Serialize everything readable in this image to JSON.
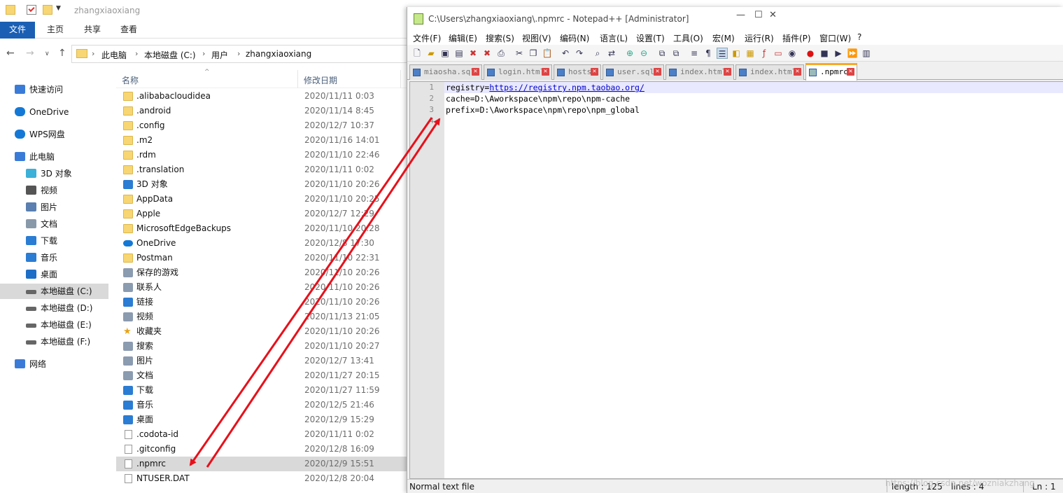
{
  "explorer": {
    "window_title": "zhangxiaoxiang",
    "ribbon_tabs": [
      "文件",
      "主页",
      "共享",
      "查看"
    ],
    "breadcrumb": [
      "此电脑",
      "本地磁盘 (C:)",
      "用户",
      "zhangxiaoxiang"
    ],
    "columns": {
      "name": "名称",
      "date": "修改日期"
    },
    "nav_items": [
      {
        "label": "快速访问",
        "icon": "star-icon"
      },
      {
        "label": "OneDrive",
        "icon": "cloud-icon"
      },
      {
        "label": "WPS网盘",
        "icon": "cloud-icon"
      },
      {
        "label": "此电脑",
        "icon": "computer-icon"
      },
      {
        "label": "3D 对象",
        "icon": "cube-icon"
      },
      {
        "label": "视频",
        "icon": "video-icon"
      },
      {
        "label": "图片",
        "icon": "picture-icon"
      },
      {
        "label": "文档",
        "icon": "document-icon"
      },
      {
        "label": "下载",
        "icon": "download-icon"
      },
      {
        "label": "音乐",
        "icon": "music-icon"
      },
      {
        "label": "桌面",
        "icon": "desktop-icon"
      },
      {
        "label": "本地磁盘 (C:)",
        "icon": "drive-icon"
      },
      {
        "label": "本地磁盘 (D:)",
        "icon": "drive-icon"
      },
      {
        "label": "本地磁盘 (E:)",
        "icon": "drive-icon"
      },
      {
        "label": "本地磁盘 (F:)",
        "icon": "drive-icon"
      },
      {
        "label": "网络",
        "icon": "network-icon"
      }
    ],
    "files": [
      {
        "name": ".alibabacloudidea",
        "date": "2020/11/11 0:03",
        "icon": "folder"
      },
      {
        "name": ".android",
        "date": "2020/11/14 8:45",
        "icon": "folder"
      },
      {
        "name": ".config",
        "date": "2020/12/7 10:37",
        "icon": "folder"
      },
      {
        "name": ".m2",
        "date": "2020/11/16 14:01",
        "icon": "folder"
      },
      {
        "name": ".rdm",
        "date": "2020/11/10 22:46",
        "icon": "folder"
      },
      {
        "name": ".translation",
        "date": "2020/11/11 0:02",
        "icon": "folder"
      },
      {
        "name": "3D 对象",
        "date": "2020/11/10 20:26",
        "icon": "cube"
      },
      {
        "name": "AppData",
        "date": "2020/11/10 20:25",
        "icon": "folder"
      },
      {
        "name": "Apple",
        "date": "2020/12/7 12:29",
        "icon": "folder"
      },
      {
        "name": "MicrosoftEdgeBackups",
        "date": "2020/11/10 20:28",
        "icon": "folder"
      },
      {
        "name": "OneDrive",
        "date": "2020/12/8 17:30",
        "icon": "cloud"
      },
      {
        "name": "Postman",
        "date": "2020/11/10 22:31",
        "icon": "folder"
      },
      {
        "name": "保存的游戏",
        "date": "2020/11/10 20:26",
        "icon": "gray"
      },
      {
        "name": "联系人",
        "date": "2020/11/10 20:26",
        "icon": "gray"
      },
      {
        "name": "链接",
        "date": "2020/11/10 20:26",
        "icon": "blue"
      },
      {
        "name": "视频",
        "date": "2020/11/13 21:05",
        "icon": "gray"
      },
      {
        "name": "收藏夹",
        "date": "2020/11/10 20:26",
        "icon": "star"
      },
      {
        "name": "搜索",
        "date": "2020/11/10 20:27",
        "icon": "gray"
      },
      {
        "name": "图片",
        "date": "2020/12/7 13:41",
        "icon": "gray"
      },
      {
        "name": "文档",
        "date": "2020/11/27 20:15",
        "icon": "gray"
      },
      {
        "name": "下载",
        "date": "2020/11/27 11:59",
        "icon": "blue"
      },
      {
        "name": "音乐",
        "date": "2020/12/5 21:46",
        "icon": "blue"
      },
      {
        "name": "桌面",
        "date": "2020/12/9 15:29",
        "icon": "blue"
      },
      {
        "name": ".codota-id",
        "date": "2020/11/11 0:02",
        "icon": "file"
      },
      {
        "name": ".gitconfig",
        "date": "2020/12/8 16:09",
        "icon": "file"
      },
      {
        "name": ".npmrc",
        "date": "2020/12/9 15:51",
        "icon": "file",
        "selected": true
      },
      {
        "name": "NTUSER.DAT",
        "date": "2020/12/8 20:04",
        "icon": "file"
      }
    ]
  },
  "notepad": {
    "title": "C:\\Users\\zhangxiaoxiang\\.npmrc - Notepad++ [Administrator]",
    "menu": [
      "文件(F)",
      "编辑(E)",
      "搜索(S)",
      "视图(V)",
      "编码(N)",
      "语言(L)",
      "设置(T)",
      "工具(O)",
      "宏(M)",
      "运行(R)",
      "插件(P)",
      "窗口(W)",
      "?"
    ],
    "tabs": [
      "miaosha.sql",
      "login.html",
      "hosts",
      "user.sql",
      "index.html",
      "index.html",
      ".npmrc"
    ],
    "active_tab": ".npmrc",
    "lines": [
      {
        "num": "1",
        "prefix": "registry=",
        "url": "https://registry.npm.taobao.org/"
      },
      {
        "num": "2",
        "text": "cache=D:\\Aworkspace\\npm\\repo\\npm-cache"
      },
      {
        "num": "3",
        "text": "prefix=D:\\Aworkspace\\npm\\repo\\npm_global"
      },
      {
        "num": "4",
        "text": ""
      }
    ],
    "status": {
      "type": "Normal text file",
      "length": "length : 125",
      "lines": "lines : 4",
      "ln": "Ln : 1"
    }
  },
  "watermark": "https://blog.csdn.net/wozniakzhang",
  "colors": {
    "ribbon_active": "#1b5fb4",
    "arrow": "#e8101a",
    "selection": "#d9d9d9"
  }
}
